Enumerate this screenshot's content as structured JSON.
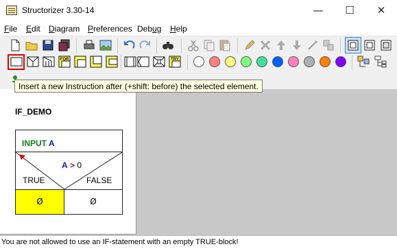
{
  "window": {
    "title": "Structorizer 3.30-14",
    "minimize_glyph": "—",
    "maximize_glyph": "☐",
    "close_glyph": "✕"
  },
  "menu": [
    {
      "label_first": "F",
      "label_rest": "ile"
    },
    {
      "label_first": "E",
      "label_rest": "dit"
    },
    {
      "label_first": "D",
      "label_rest": "iagram"
    },
    {
      "label_first": "P",
      "label_rest": "references"
    },
    {
      "label_first": "Deb",
      "label_rest": "ug",
      "underline_index": 3
    },
    {
      "label_first": "H",
      "label_rest": "elp"
    }
  ],
  "toolbar": {
    "tooltip": "Insert a new Instruction after (+shift: before) the selected element.",
    "colors": [
      "#ffffff",
      "#ff8080",
      "#ffff80",
      "#80ff80",
      "#40e0a0",
      "#0060ff",
      "#ff80c0",
      "#b0b0b0",
      "#ff8000",
      "#8000ff"
    ],
    "labels": {
      "for": "FOR",
      "try": "TRY"
    }
  },
  "diagram": {
    "name": "IF_DEMO",
    "input_keyword": "INPUT",
    "input_var": "A",
    "cond_var": "A",
    "cond_op": ">",
    "cond_value": "0",
    "true_label": "TRUE",
    "false_label": "FALSE",
    "empty_symbol": "Ø",
    "true_color": "#ffff00"
  },
  "status": {
    "message": "You are not allowed to use an IF-statement with an empty TRUE-block!"
  }
}
